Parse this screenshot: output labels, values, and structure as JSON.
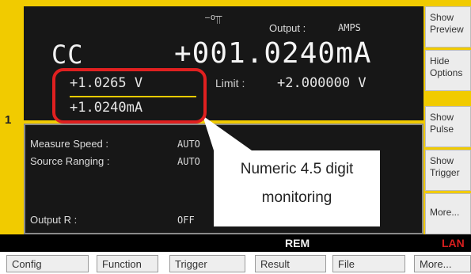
{
  "display": {
    "channel": "1",
    "mode": "CC",
    "main_value": "+001.0240mA",
    "output_symbol": "⁻⁰⫪",
    "output_label": "Output :",
    "output_value": "AMPS",
    "voltage_monitor": "+1.0265  V",
    "limit_label": "Limit :",
    "limit_value": "+2.000000  V",
    "current_monitor": "+1.0240mA"
  },
  "parameters": [
    {
      "label": "Measure Speed :",
      "value": "AUTO"
    },
    {
      "label": "Source Ranging :",
      "value": "AUTO"
    },
    {
      "label": "Output R :",
      "value": "OFF"
    }
  ],
  "softkeys": [
    "Show\nPreview",
    "Hide\nOptions",
    "Show\nPulse",
    "Show\nTrigger",
    "More..."
  ],
  "status": {
    "rem": "REM",
    "lan": "LAN"
  },
  "menu": [
    "Config",
    "Function",
    "Trigger",
    "Result",
    "File",
    "More..."
  ],
  "callout": {
    "line1": "Numeric 4.5 digit",
    "line2": "monitoring"
  },
  "colors": {
    "frame": "#f1cb00",
    "screen": "#171717",
    "highlight": "#e02020",
    "lan": "#d61e1e"
  }
}
